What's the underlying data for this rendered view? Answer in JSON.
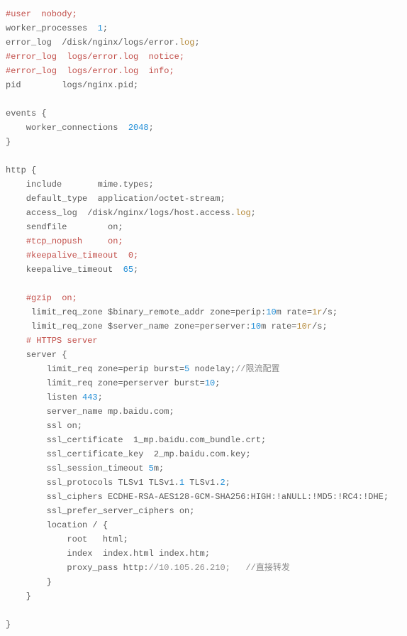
{
  "lines": [
    [
      [
        "comment",
        "#user  nobody;"
      ]
    ],
    [
      [
        "kw",
        "worker_processes  "
      ],
      [
        "num",
        "1"
      ],
      [
        "kw",
        ";"
      ]
    ],
    [
      [
        "kw",
        "error_log  /disk/nginx/logs/error."
      ],
      [
        "log",
        "log"
      ],
      [
        "kw",
        ";"
      ]
    ],
    [
      [
        "comment",
        "#error_log  logs/error.log  notice;"
      ]
    ],
    [
      [
        "comment",
        "#error_log  logs/error.log  info;"
      ]
    ],
    [
      [
        "kw",
        "pid        logs/nginx.pid;"
      ]
    ],
    [
      [
        "kw",
        ""
      ]
    ],
    [
      [
        "kw",
        "events {"
      ]
    ],
    [
      [
        "kw",
        "    worker_connections  "
      ],
      [
        "num",
        "2048"
      ],
      [
        "kw",
        ";"
      ]
    ],
    [
      [
        "kw",
        "}"
      ]
    ],
    [
      [
        "kw",
        ""
      ]
    ],
    [
      [
        "kw",
        "http {"
      ]
    ],
    [
      [
        "kw",
        "    include       mime.types;"
      ]
    ],
    [
      [
        "kw",
        "    default_type  application/octet-stream;"
      ]
    ],
    [
      [
        "kw",
        "    access_log  /disk/nginx/logs/host.access."
      ],
      [
        "log",
        "log"
      ],
      [
        "kw",
        ";"
      ]
    ],
    [
      [
        "kw",
        "    sendfile        on;"
      ]
    ],
    [
      [
        "kw",
        "    "
      ],
      [
        "comment",
        "#tcp_nopush     on;"
      ]
    ],
    [
      [
        "kw",
        "    "
      ],
      [
        "comment",
        "#keepalive_timeout  0;"
      ]
    ],
    [
      [
        "kw",
        "    keepalive_timeout  "
      ],
      [
        "num",
        "65"
      ],
      [
        "kw",
        ";"
      ]
    ],
    [
      [
        "kw",
        ""
      ]
    ],
    [
      [
        "kw",
        "    "
      ],
      [
        "comment",
        "#gzip  on;"
      ]
    ],
    [
      [
        "kw",
        "     limit_req_zone $binary_remote_addr zone=perip:"
      ],
      [
        "num",
        "10"
      ],
      [
        "kw",
        "m rate="
      ],
      [
        "ratio",
        "1r"
      ],
      [
        "kw",
        "/s;"
      ]
    ],
    [
      [
        "kw",
        "     limit_req_zone $server_name zone=perserver:"
      ],
      [
        "num",
        "10"
      ],
      [
        "kw",
        "m rate="
      ],
      [
        "ratio",
        "10r"
      ],
      [
        "kw",
        "/s;"
      ]
    ],
    [
      [
        "kw",
        "    "
      ],
      [
        "comment",
        "# HTTPS server"
      ]
    ],
    [
      [
        "kw",
        "    server {"
      ]
    ],
    [
      [
        "kw",
        "        limit_req zone=perip burst="
      ],
      [
        "num",
        "5"
      ],
      [
        "kw",
        " nodelay;"
      ],
      [
        "slash",
        "//限流配置"
      ]
    ],
    [
      [
        "kw",
        "        limit_req zone=perserver burst="
      ],
      [
        "num",
        "10"
      ],
      [
        "kw",
        ";"
      ]
    ],
    [
      [
        "kw",
        "        listen "
      ],
      [
        "num",
        "443"
      ],
      [
        "kw",
        ";"
      ]
    ],
    [
      [
        "kw",
        "        server_name mp.baidu.com;"
      ]
    ],
    [
      [
        "kw",
        "        ssl on;"
      ]
    ],
    [
      [
        "kw",
        "        ssl_certificate  1_mp.baidu.com_bundle.crt;"
      ]
    ],
    [
      [
        "kw",
        "        ssl_certificate_key  2_mp.baidu.com.key;"
      ]
    ],
    [
      [
        "kw",
        "        ssl_session_timeout "
      ],
      [
        "num",
        "5"
      ],
      [
        "kw",
        "m;"
      ]
    ],
    [
      [
        "kw",
        "        ssl_protocols TLSv1 TLSv1."
      ],
      [
        "num",
        "1"
      ],
      [
        "kw",
        " TLSv1."
      ],
      [
        "num",
        "2"
      ],
      [
        "kw",
        ";"
      ]
    ],
    [
      [
        "kw",
        "        ssl_ciphers ECDHE-RSA-AES128-GCM-SHA256:HIGH:!aNULL:!MD5:!RC4:!DHE;"
      ]
    ],
    [
      [
        "kw",
        "        ssl_prefer_server_ciphers on;"
      ]
    ],
    [
      [
        "kw",
        "        location / {"
      ]
    ],
    [
      [
        "kw",
        "            root   html;"
      ]
    ],
    [
      [
        "kw",
        "            index  index.html index.htm;"
      ]
    ],
    [
      [
        "kw",
        "            proxy_pass http:"
      ],
      [
        "url",
        "//10.105.26.210;   //直接转发"
      ]
    ],
    [
      [
        "kw",
        "        }"
      ]
    ],
    [
      [
        "kw",
        "    }"
      ]
    ],
    [
      [
        "kw",
        ""
      ]
    ],
    [
      [
        "kw",
        "}"
      ]
    ]
  ],
  "classmap": {
    "comment": "t-comment",
    "kw": "t-kw",
    "num": "t-num",
    "log": "t-log",
    "slash": "t-slash",
    "url": "t-url",
    "ratio": "t-ratio"
  }
}
